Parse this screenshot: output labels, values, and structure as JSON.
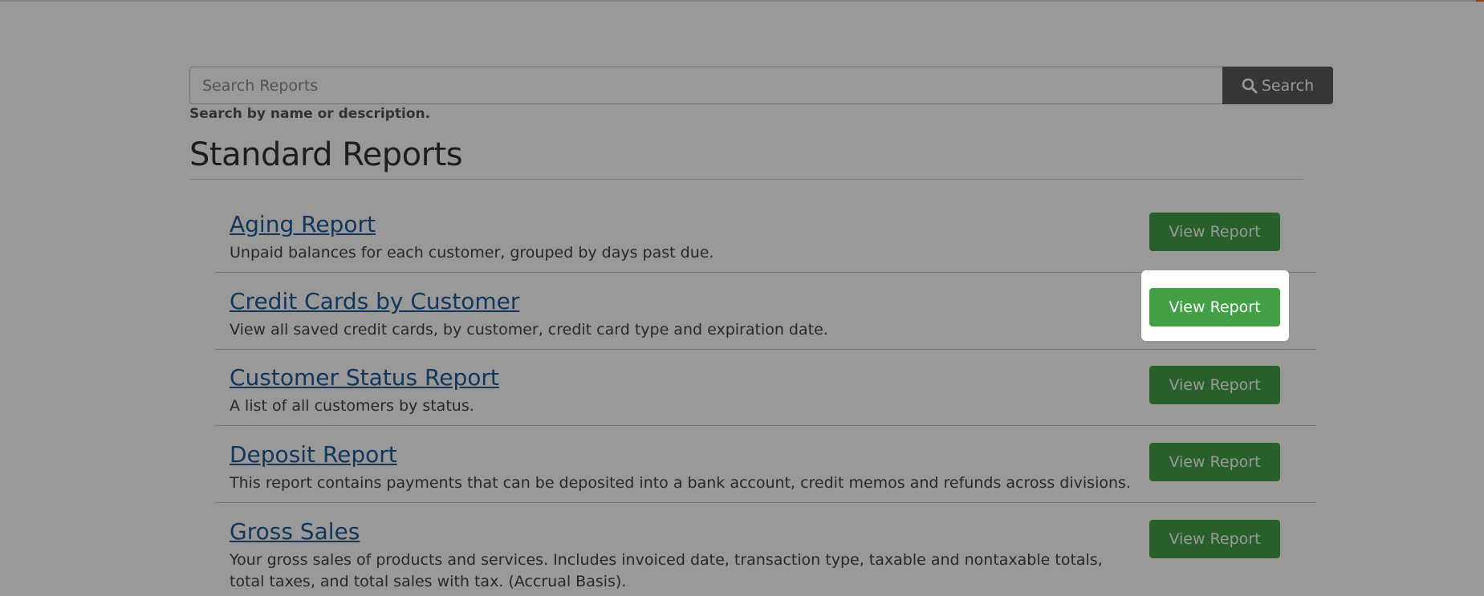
{
  "search": {
    "placeholder": "Search Reports",
    "button_label": "Search",
    "help": "Search by name or description."
  },
  "section": {
    "title": "Standard Reports"
  },
  "reports": [
    {
      "name": "Aging Report",
      "description": "Unpaid balances for each customer, grouped by days past due.",
      "button": "View Report"
    },
    {
      "name": "Credit Cards by Customer",
      "description": "View all saved credit cards, by customer, credit card type and expiration date.",
      "button": "View Report"
    },
    {
      "name": "Customer Status Report",
      "description": "A list of all customers by status.",
      "button": "View Report"
    },
    {
      "name": "Deposit Report",
      "description": "This report contains payments that can be deposited into a bank account, credit memos and refunds across divisions.",
      "button": "View Report"
    },
    {
      "name": "Gross Sales",
      "description": "Your gross sales of products and services. Includes invoiced date, transaction type, taxable and nontaxable totals, total taxes, and total sales with tax. (Accrual Basis).",
      "button": "View Report"
    }
  ],
  "highlighted_report_index": 1,
  "colors": {
    "button_green": "#43a047",
    "link_blue": "#1e5a9a",
    "search_button": "#5a5a5a",
    "top_accent": "#e8702a"
  },
  "icons": {
    "search": "magnifier-icon"
  }
}
